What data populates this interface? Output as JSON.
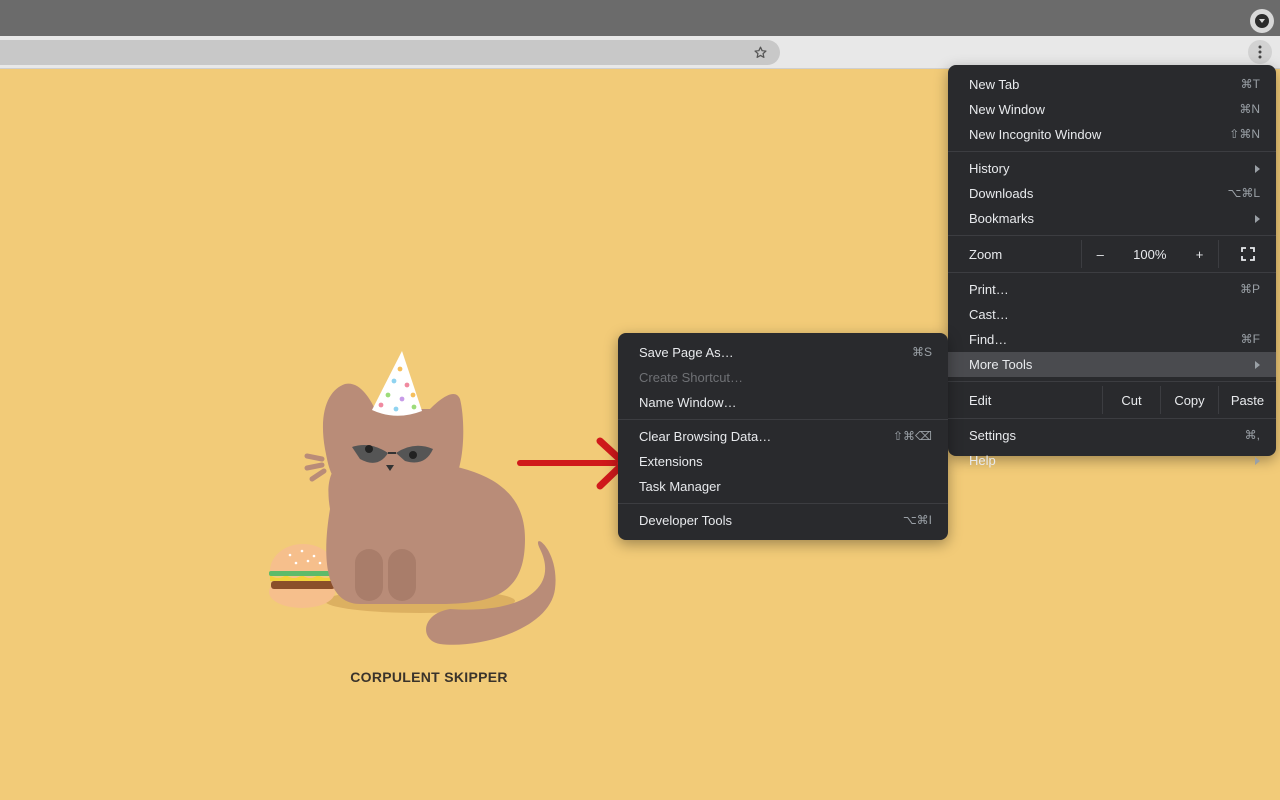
{
  "browser": {
    "menu": {
      "items_top": [
        {
          "label": "New Tab",
          "shortcut": "⌘T"
        },
        {
          "label": "New Window",
          "shortcut": "⌘N"
        },
        {
          "label": "New Incognito Window",
          "shortcut": "⇧⌘N"
        }
      ],
      "history": "History",
      "downloads": {
        "label": "Downloads",
        "shortcut": "⌥⌘L"
      },
      "bookmarks": "Bookmarks",
      "zoom": {
        "label": "Zoom",
        "minus": "–",
        "value": "100%",
        "plus": "+"
      },
      "print": {
        "label": "Print…",
        "shortcut": "⌘P"
      },
      "cast": "Cast…",
      "find": {
        "label": "Find…",
        "shortcut": "⌘F"
      },
      "more_tools": "More Tools",
      "edit": {
        "label": "Edit",
        "cut": "Cut",
        "copy": "Copy",
        "paste": "Paste"
      },
      "settings": {
        "label": "Settings",
        "shortcut": "⌘,"
      },
      "help": "Help"
    },
    "more_tools_menu": {
      "save_page": {
        "label": "Save Page As…",
        "shortcut": "⌘S"
      },
      "create_shortcut": "Create Shortcut…",
      "name_window": "Name Window…",
      "clear_data": {
        "label": "Clear Browsing Data…",
        "shortcut": "⇧⌘⌫"
      },
      "extensions": "Extensions",
      "task_manager": "Task Manager",
      "dev_tools": {
        "label": "Developer Tools",
        "shortcut": "⌥⌘I"
      }
    }
  },
  "page": {
    "caption": "CORPULENT SKIPPER"
  },
  "colors": {
    "page_bg": "#f2cb78",
    "menu_bg": "#292a2d",
    "cat": "#b98c78",
    "arrow": "#d0191b"
  }
}
